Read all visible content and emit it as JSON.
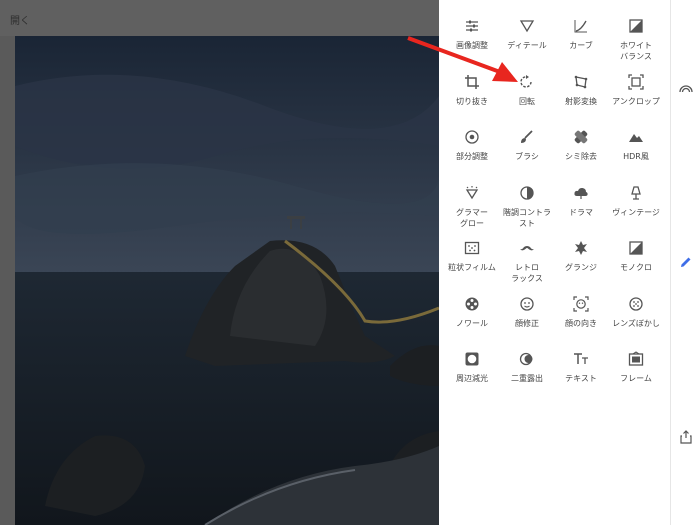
{
  "header": {
    "open_label": "開く"
  },
  "tools": [
    {
      "label": "画像調整",
      "icon": "sliders-icon"
    },
    {
      "label": "ディテール",
      "icon": "triangle-down-icon"
    },
    {
      "label": "カーブ",
      "icon": "curve-icon"
    },
    {
      "label": "ホワイト\nバランス",
      "icon": "white-balance-icon"
    },
    {
      "label": "切り抜き",
      "icon": "crop-icon"
    },
    {
      "label": "回転",
      "icon": "rotate-icon"
    },
    {
      "label": "射影変換",
      "icon": "perspective-icon"
    },
    {
      "label": "アンクロップ",
      "icon": "expand-icon"
    },
    {
      "label": "部分調整",
      "icon": "selective-icon"
    },
    {
      "label": "ブラシ",
      "icon": "brush-icon"
    },
    {
      "label": "シミ除去",
      "icon": "healing-icon"
    },
    {
      "label": "HDR風",
      "icon": "mountain-icon"
    },
    {
      "label": "グラマー\nグロー",
      "icon": "glamour-icon"
    },
    {
      "label": "階調コントラ\nスト",
      "icon": "tonal-contrast-icon"
    },
    {
      "label": "ドラマ",
      "icon": "cloud-icon"
    },
    {
      "label": "ヴィンテージ",
      "icon": "lamp-icon"
    },
    {
      "label": "粒状フィルム",
      "icon": "film-grain-icon"
    },
    {
      "label": "レトロ\nラックス",
      "icon": "mustache-icon"
    },
    {
      "label": "グランジ",
      "icon": "grunge-icon"
    },
    {
      "label": "モノクロ",
      "icon": "monochrome-icon"
    },
    {
      "label": "ノワール",
      "icon": "film-reel-icon"
    },
    {
      "label": "顔修正",
      "icon": "face-icon"
    },
    {
      "label": "顔の向き",
      "icon": "face-pose-icon"
    },
    {
      "label": "レンズぼかし",
      "icon": "lens-blur-icon"
    },
    {
      "label": "周辺減光",
      "icon": "vignette-icon"
    },
    {
      "label": "二重露出",
      "icon": "double-exposure-icon"
    },
    {
      "label": "テキスト",
      "icon": "text-icon"
    },
    {
      "label": "フレーム",
      "icon": "frame-icon"
    }
  ],
  "rail": [
    "looks-icon",
    "edit-pencil-icon",
    "share-icon"
  ],
  "colors": {
    "accent": "#3f6ee8",
    "arrow": "#e8261f"
  }
}
